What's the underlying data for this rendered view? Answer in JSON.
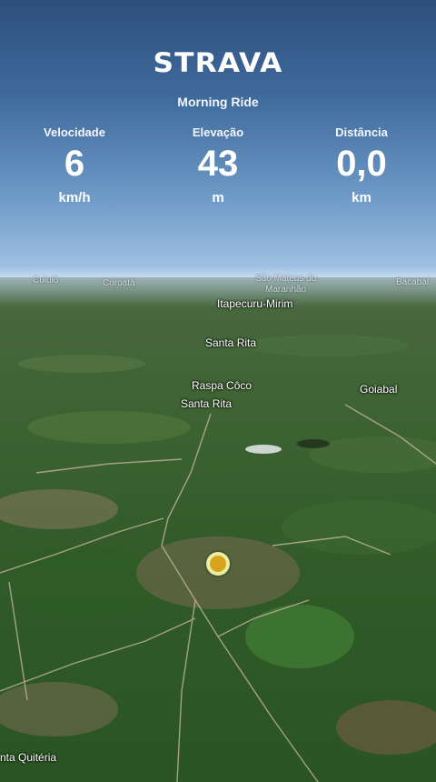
{
  "app": {
    "logo": "STRAVA",
    "activity_title": "Morning Ride"
  },
  "stats": [
    {
      "label": "Velocidade",
      "value": "6",
      "unit": "km/h"
    },
    {
      "label": "Elevação",
      "value": "43",
      "unit": "m"
    },
    {
      "label": "Distância",
      "value": "0,0",
      "unit": "km"
    }
  ],
  "map": {
    "horizon_labels": [
      "Cululó",
      "Coroatá",
      "São Mateus do",
      "Maranhão",
      "Bacabal"
    ],
    "labels": [
      "Itapecuru-Mirim",
      "Santa Rita",
      "Raspa Côco",
      "Santa Rita",
      "Goiabal",
      "nta Quitéria"
    ],
    "current_position_marker": "location-dot-icon"
  }
}
